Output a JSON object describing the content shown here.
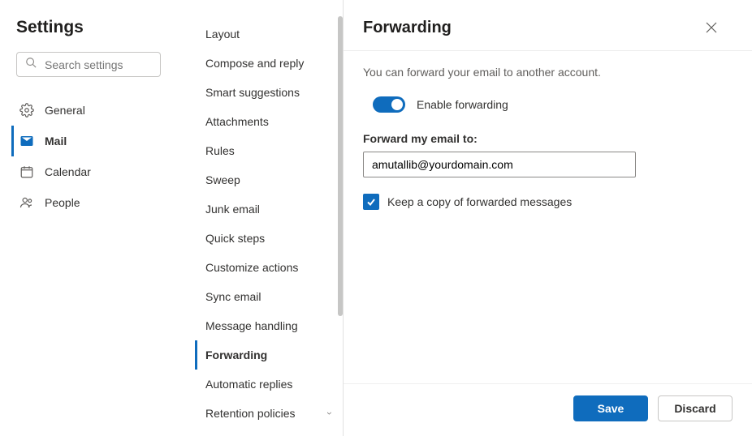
{
  "sidebar": {
    "title": "Settings",
    "search_placeholder": "Search settings",
    "items": [
      {
        "label": "General",
        "icon": "gear"
      },
      {
        "label": "Mail",
        "icon": "mail",
        "active": true
      },
      {
        "label": "Calendar",
        "icon": "calendar"
      },
      {
        "label": "People",
        "icon": "people"
      }
    ]
  },
  "subnav": {
    "items": [
      "Layout",
      "Compose and reply",
      "Smart suggestions",
      "Attachments",
      "Rules",
      "Sweep",
      "Junk email",
      "Quick steps",
      "Customize actions",
      "Sync email",
      "Message handling",
      "Forwarding",
      "Automatic replies",
      "Retention policies"
    ],
    "active": "Forwarding"
  },
  "main": {
    "title": "Forwarding",
    "description": "You can forward your email to another account.",
    "enable_label": "Enable forwarding",
    "enable_value": true,
    "forward_label": "Forward my email to:",
    "forward_value": "amutallib@yourdomain.com",
    "keep_copy_label": "Keep a copy of forwarded messages",
    "keep_copy_value": true,
    "save_label": "Save",
    "discard_label": "Discard"
  }
}
